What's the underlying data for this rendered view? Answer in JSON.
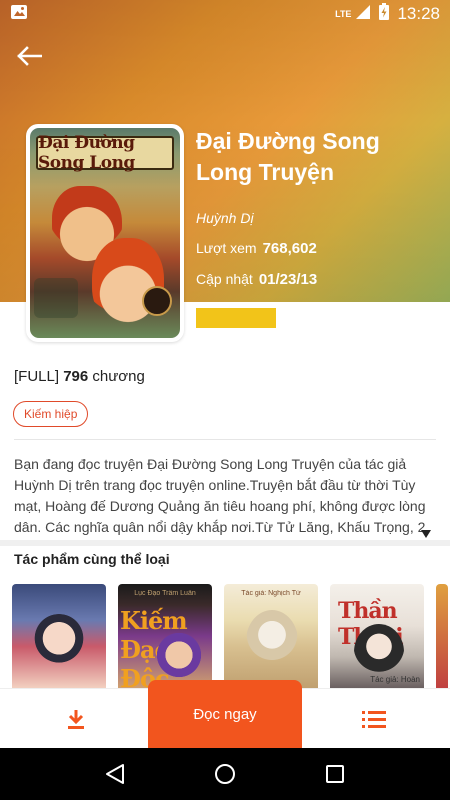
{
  "status_bar": {
    "time": "13:28",
    "network": "LTE",
    "colors": {
      "text": "#ffffff"
    }
  },
  "book": {
    "title": "Đại Đường Song Long Truyện",
    "cover_title": "Đại Đường Song Long",
    "author": "Huỳnh Dị",
    "views_label": "Lượt xem",
    "views_value": "768,602",
    "updated_label": "Cập nhật",
    "updated_value": "01/23/13",
    "status_prefix": "[FULL]",
    "chapter_count": "796",
    "chapter_suffix": "chương",
    "genre": "Kiếm hiệp",
    "description": "Bạn đang đọc truyện Đại Đường Song Long Truyện của tác giả Huỳnh Dị trên trang đọc truyện online.Truyện bắt đầu từ thời Tùy mạt, Hoàng đế Dương Quảng ăn tiêu hoang phí, không được lòng dân. Các nghĩa quân nổi dậy khắp nơi.Từ Tử Lăng, Khấu Trọng, 2 đứa trẻ mồ côi ở Dương Châu, sau khi vô tình lấy được Trường"
  },
  "related": {
    "title": "Tác phẩm cùng thể loại",
    "items": [
      {
        "top_text": "",
        "big_text": ""
      },
      {
        "top_text": "Lục Đạo Trầm Luân",
        "big_text": "Kiếm Đạo Độc"
      },
      {
        "top_text": "Tác giả: Nghịch Tử",
        "big_text": ""
      },
      {
        "top_text": "Tác giả: Hoàn",
        "big_text": "Thần Thoại"
      }
    ]
  },
  "actions": {
    "read_label": "Đọc ngay"
  },
  "colors": {
    "accent": "#f2551e",
    "tag": "#e04a2a",
    "rating": "#f2c419"
  }
}
